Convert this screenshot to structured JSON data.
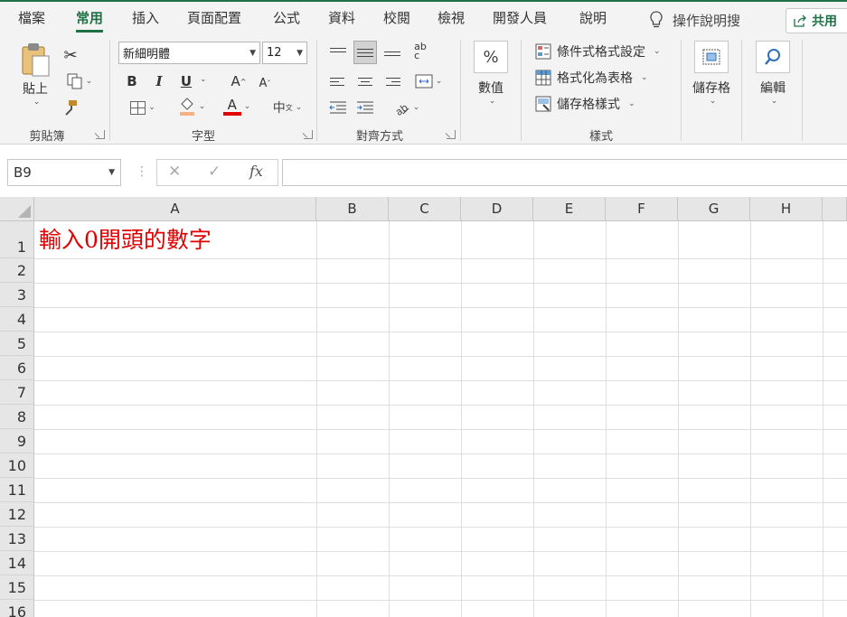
{
  "tabs": [
    {
      "label": "檔案",
      "active": false
    },
    {
      "label": "常用",
      "active": true
    },
    {
      "label": "插入",
      "active": false
    },
    {
      "label": "頁面配置",
      "active": false
    },
    {
      "label": "公式",
      "active": false
    },
    {
      "label": "資料",
      "active": false
    },
    {
      "label": "校閱",
      "active": false
    },
    {
      "label": "檢視",
      "active": false
    },
    {
      "label": "開發人員",
      "active": false
    },
    {
      "label": "說明",
      "active": false
    }
  ],
  "tell_me": "操作說明搜",
  "share": "共用",
  "clipboard": {
    "paste": "貼上",
    "group": "剪貼簿"
  },
  "font": {
    "name": "新細明體",
    "size": "12",
    "group": "字型",
    "bold": "B",
    "italic": "I",
    "underline": "U",
    "grow": "A",
    "shrink": "A",
    "font_color_letter": "A",
    "phonetic": "中",
    "phonetic_sub": "文"
  },
  "alignment": {
    "group": "對齊方式",
    "wrap": "ab\nc"
  },
  "number": {
    "label": "數值",
    "symbol": "%"
  },
  "styles": {
    "conditional": "條件式格式設定",
    "table": "格式化為表格",
    "cell_styles": "儲存格樣式",
    "group": "樣式"
  },
  "cells": {
    "label": "儲存格"
  },
  "editing": {
    "label": "編輯"
  },
  "formula_bar": {
    "name_box": "B9",
    "fx": "fx",
    "value": ""
  },
  "columns": [
    "A",
    "B",
    "C",
    "D",
    "E",
    "F",
    "G",
    "H"
  ],
  "rows": [
    "1",
    "2",
    "3",
    "4",
    "5",
    "6",
    "7",
    "8",
    "9",
    "10",
    "11",
    "12",
    "13",
    "14",
    "15",
    "16"
  ],
  "cell_A1": "輸入0開頭的數字",
  "colors": {
    "accent": "#1e7145",
    "cell_text": "#e00000"
  }
}
